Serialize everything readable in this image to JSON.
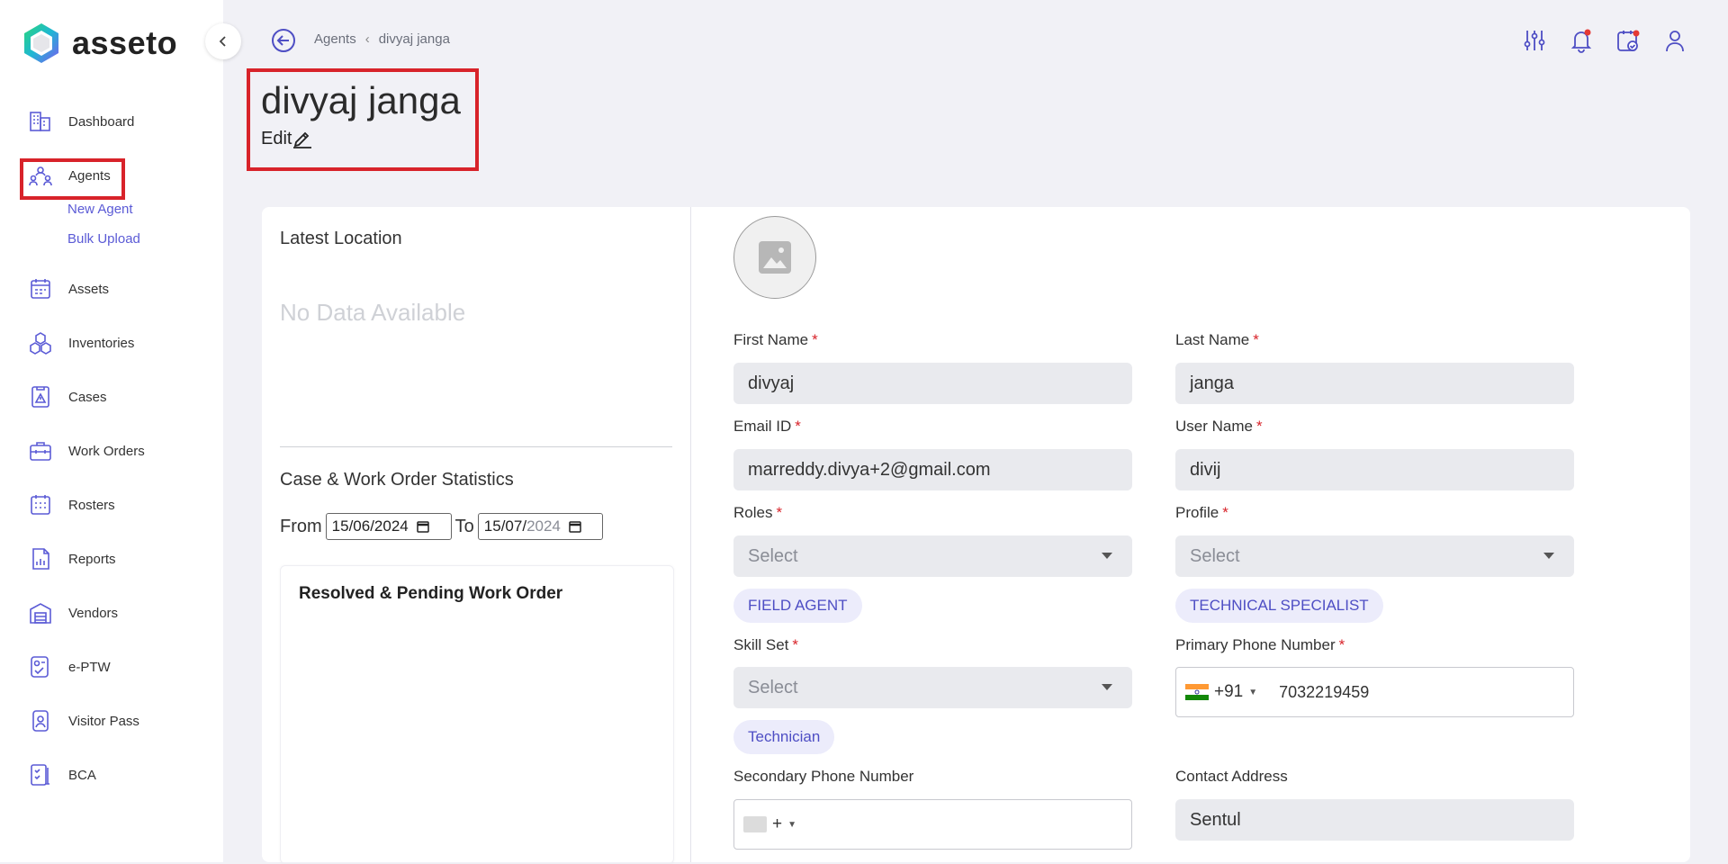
{
  "brand": {
    "name": "asseto"
  },
  "sidebar": {
    "items": [
      {
        "label": "Dashboard",
        "icon": "building-icon"
      },
      {
        "label": "Agents",
        "icon": "agents-icon"
      },
      {
        "label": "Assets",
        "icon": "assets-icon"
      },
      {
        "label": "Inventories",
        "icon": "inventories-icon"
      },
      {
        "label": "Cases",
        "icon": "cases-icon"
      },
      {
        "label": "Work Orders",
        "icon": "work-orders-icon"
      },
      {
        "label": "Rosters",
        "icon": "rosters-icon"
      },
      {
        "label": "Reports",
        "icon": "reports-icon"
      },
      {
        "label": "Vendors",
        "icon": "vendors-icon"
      },
      {
        "label": "e-PTW",
        "icon": "eptw-icon"
      },
      {
        "label": "Visitor Pass",
        "icon": "visitor-pass-icon"
      },
      {
        "label": "BCA",
        "icon": "bca-icon"
      }
    ],
    "agents_sub": [
      "New Agent",
      "Bulk Upload"
    ]
  },
  "breadcrumb": {
    "parent": "Agents",
    "current": "divyaj janga"
  },
  "page": {
    "title": "divyaj janga",
    "edit_label": "Edit"
  },
  "left": {
    "latest_location": "Latest Location",
    "no_data": "No Data Available",
    "stats_title": "Case & Work Order Statistics",
    "from_label": "From",
    "to_label": "To",
    "from_date": "15/06/2024",
    "to_date_day": "15/07/",
    "to_date_year": "2024",
    "wo_title": "Resolved & Pending Work Order"
  },
  "form": {
    "first_name": {
      "label": "First Name",
      "value": "divyaj"
    },
    "last_name": {
      "label": "Last Name",
      "value": "janga"
    },
    "email": {
      "label": "Email ID",
      "value": "marreddy.divya+2@gmail.com"
    },
    "username": {
      "label": "User Name",
      "value": "divij"
    },
    "roles": {
      "label": "Roles",
      "placeholder": "Select",
      "chip": "FIELD AGENT"
    },
    "profile": {
      "label": "Profile",
      "placeholder": "Select",
      "chip": "TECHNICAL SPECIALIST"
    },
    "skill_set": {
      "label": "Skill Set",
      "placeholder": "Select",
      "chip": "Technician"
    },
    "primary_phone": {
      "label": "Primary Phone Number",
      "code": "+91",
      "number": "7032219459"
    },
    "secondary_phone": {
      "label": "Secondary Phone Number",
      "code": "+"
    },
    "contact_address": {
      "label": "Contact Address",
      "value": "Sentul"
    },
    "required_mark": "*"
  },
  "colors": {
    "accent": "#5b5bd6",
    "highlight": "#d8232a",
    "field_bg": "#e9eaee",
    "chip_bg": "#ececfb"
  }
}
